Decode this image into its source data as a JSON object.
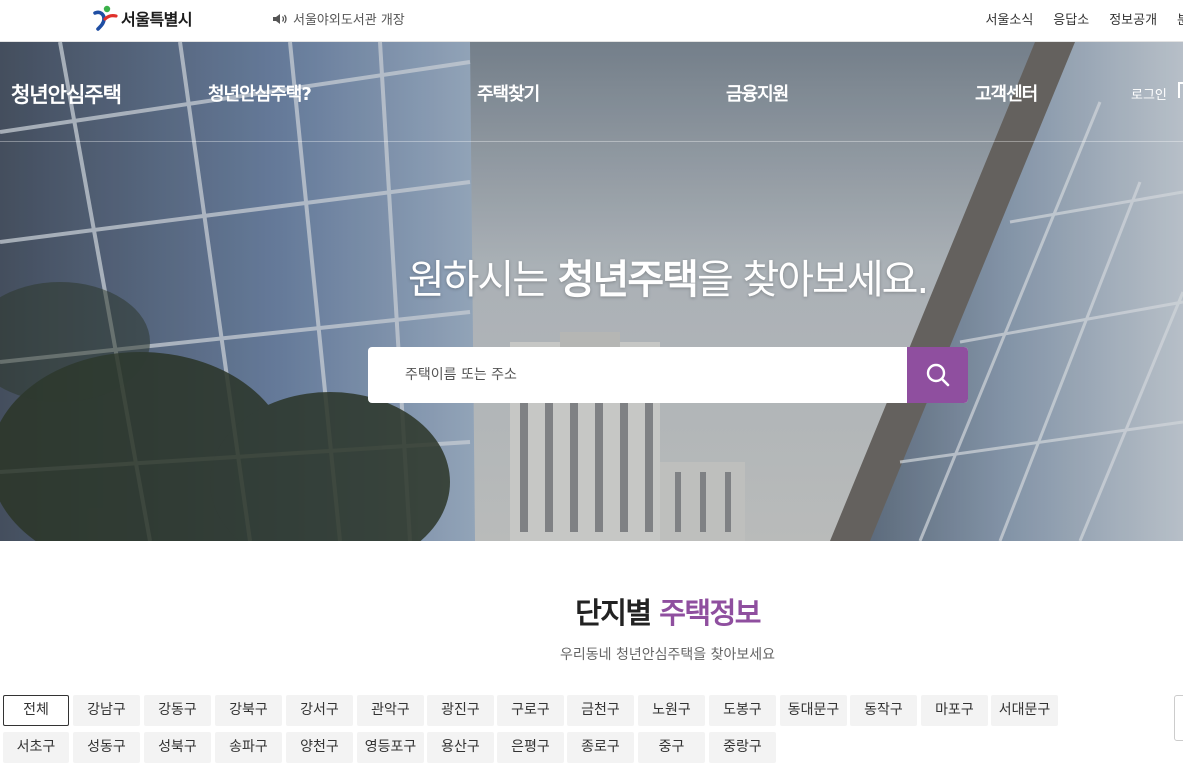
{
  "topbar": {
    "logo_text": "서울특별시",
    "notice": "서울야외도서관 개장",
    "util_links": [
      "서울소식",
      "응답소",
      "정보공개",
      "분"
    ]
  },
  "gnb": {
    "brand": "청년안심주택",
    "items": [
      "청년안심주택?",
      "주택찾기",
      "금융지원",
      "고객센터"
    ],
    "login": "로그인"
  },
  "hero": {
    "title_pre": "원하시는 ",
    "title_bold": "청년주택",
    "title_post": "을 찾아보세요.",
    "search_placeholder": "주택이름 또는 주소"
  },
  "section": {
    "title_main": "단지별 ",
    "title_accent": "주택정보",
    "subtitle": "우리동네 청년안심주택을 찾아보세요"
  },
  "districts": {
    "selected": "전체",
    "row1": [
      "전체",
      "강남구",
      "강동구",
      "강북구",
      "강서구",
      "관악구",
      "광진구",
      "구로구",
      "금천구",
      "노원구",
      "도봉구",
      "동대문구",
      "동작구",
      "마포구",
      "서대문구"
    ],
    "row2": [
      "서초구",
      "성동구",
      "성북구",
      "송파구",
      "양천구",
      "영등포구",
      "용산구",
      "은평구",
      "종로구",
      "중구",
      "중랑구"
    ]
  },
  "colors": {
    "accent": "#8f4f9f",
    "chip_bg": "#f3f3f3",
    "logo_blue": "#1f4ea3",
    "logo_red": "#e0312b",
    "logo_green": "#3bb14a"
  },
  "icons": [
    "speaker-icon",
    "search-icon",
    "seoul-logo-icon"
  ]
}
